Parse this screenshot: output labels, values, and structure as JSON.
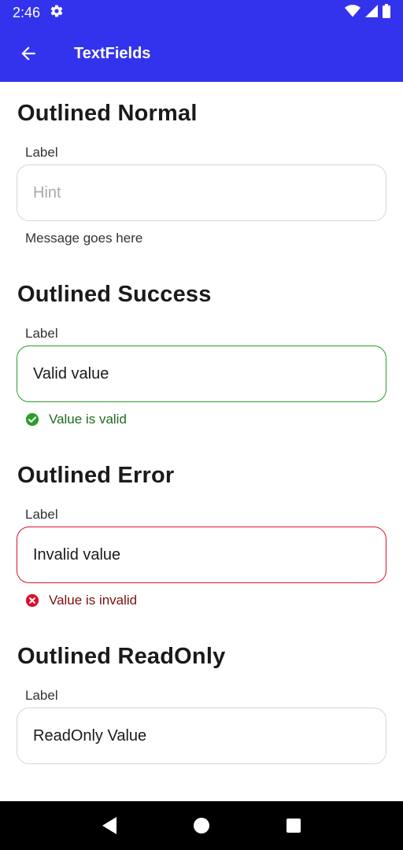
{
  "status_bar": {
    "time": "2:46"
  },
  "app_bar": {
    "title": "TextFields"
  },
  "sections": [
    {
      "title": "Outlined Normal",
      "label": "Label",
      "hint": "Hint",
      "message": "Message goes here"
    },
    {
      "title": "Outlined Success",
      "label": "Label",
      "value": "Valid value",
      "message": "Value is valid"
    },
    {
      "title": "Outlined Error",
      "label": "Label",
      "value": "Invalid value",
      "message": "Value is invalid"
    },
    {
      "title": "Outlined ReadOnly",
      "label": "Label",
      "value": "ReadOnly Value"
    }
  ],
  "colors": {
    "primary": "#3333ee",
    "success": "#2a9d2a",
    "error": "#e0102a"
  }
}
